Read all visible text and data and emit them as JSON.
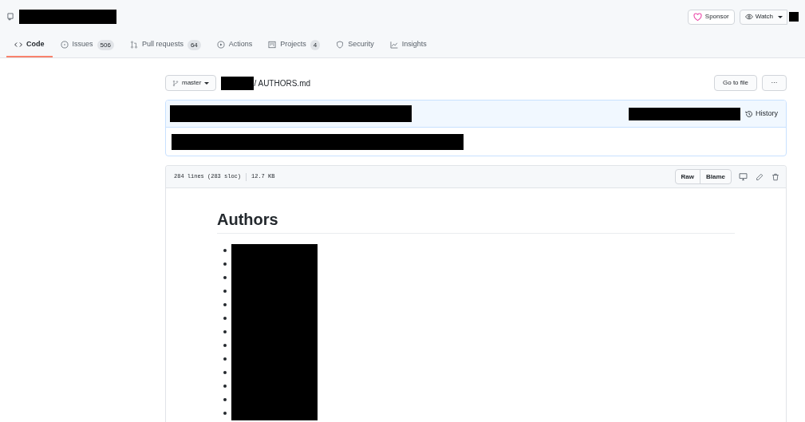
{
  "header": {
    "actions": [
      {
        "kind": "sponsor",
        "label": "Sponsor"
      },
      {
        "kind": "watch",
        "label": "Watch"
      }
    ]
  },
  "tabs": [
    {
      "kind": "code",
      "label": "Code",
      "selected": true
    },
    {
      "kind": "issue",
      "label": "Issues",
      "count": "506",
      "selected": false
    },
    {
      "kind": "pr",
      "label": "Pull requests",
      "count": "64",
      "selected": false
    },
    {
      "kind": "play",
      "label": "Actions",
      "selected": false
    },
    {
      "kind": "project",
      "label": "Projects",
      "count": "4",
      "selected": false
    },
    {
      "kind": "shield",
      "label": "Security",
      "selected": false
    },
    {
      "kind": "graph",
      "label": "Insights",
      "selected": false
    }
  ],
  "breadcrumb": {
    "branch": "master",
    "file": "/ AUTHORS.md",
    "buttons": [
      "Go to file",
      "···"
    ]
  },
  "commit": {
    "history": "History"
  },
  "file": {
    "lines": "284 lines (283 sloc)",
    "size": "12.7 KB",
    "buttons": [
      "Raw",
      "Blame"
    ]
  },
  "content": {
    "heading": "Authors",
    "items": [
      {
        "kind": "redacted"
      },
      {
        "kind": "redacted"
      },
      {
        "kind": "redacted"
      },
      {
        "kind": "redacted"
      },
      {
        "kind": "redacted"
      },
      {
        "kind": "redacted"
      },
      {
        "kind": "redacted"
      },
      {
        "kind": "redacted"
      },
      {
        "kind": "redacted"
      },
      {
        "kind": "redacted"
      },
      {
        "kind": "redacted"
      },
      {
        "kind": "redacted"
      },
      {
        "kind": "redacted"
      }
    ]
  }
}
